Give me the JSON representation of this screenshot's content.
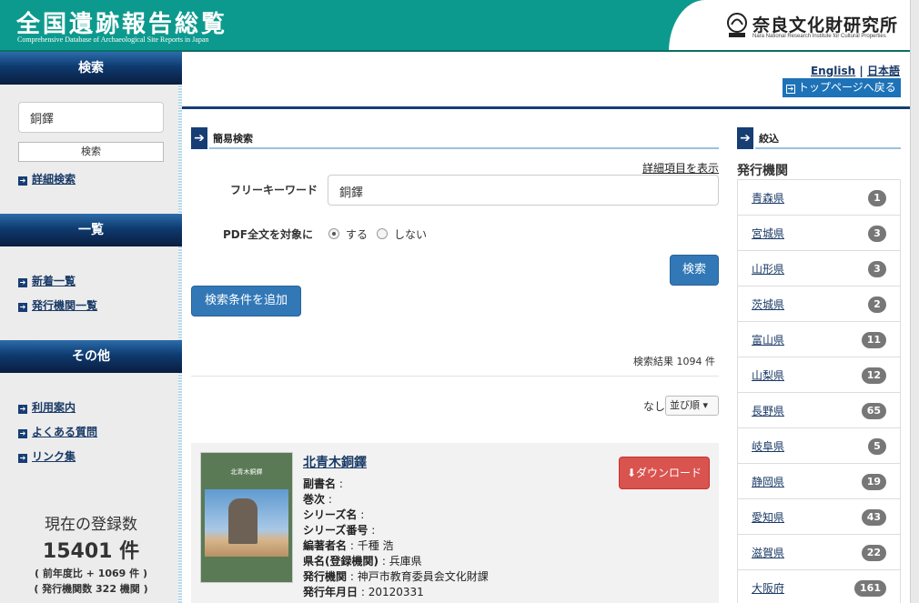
{
  "header": {
    "title": "全国遺跡報告総覧",
    "subtitle": "Comprehensive Database of Archaeological Site Reports in Japan",
    "org_name": "奈良文化財研究所",
    "org_sub": "Nara National Research Institute for Cultural Properties"
  },
  "nav": {
    "lang_en": "English",
    "lang_sep": "|",
    "lang_ja": "日本語",
    "top_page": "トップページへ戻る"
  },
  "sidebar": {
    "search_head": "検索",
    "search_value": "銅鐸",
    "search_button": "検索",
    "detail_search": "詳細検索",
    "list_head": "一覧",
    "list_items": [
      "新着一覧",
      "発行機関一覧"
    ],
    "other_head": "その他",
    "other_items": [
      "利用案内",
      "よくある質問",
      "リンク集"
    ],
    "registered_label": "現在の登録数",
    "registered_count": "15401 件",
    "yoy": "( 前年度比 + 1069 件 )",
    "orgs": "( 発行機関数 322 機関 )"
  },
  "simple_search": {
    "heading": "簡易検索",
    "show_detail": "詳細項目を表示",
    "keyword_label": "フリーキーワード",
    "keyword_value": "銅鐸",
    "pdf_label": "PDF全文を対象に",
    "pdf_yes": "する",
    "pdf_no": "しない",
    "search_button": "検索",
    "add_condition": "検索条件を追加"
  },
  "results": {
    "count_text": "検索結果 1094 件",
    "sort_none": "なし",
    "sort_label": "並び順",
    "items": [
      {
        "title": "北青木銅鐸",
        "cover_title": "北青木銅鐸",
        "fields": [
          {
            "label": "副書名",
            "value": ":"
          },
          {
            "label": "巻次",
            "value": ":"
          },
          {
            "label": "シリーズ名",
            "value": ":"
          },
          {
            "label": "シリーズ番号",
            "value": ":"
          },
          {
            "label": "編著者名",
            "value": ": 千種 浩"
          },
          {
            "label": "県名(登録機関)",
            "value": ": 兵庫県"
          },
          {
            "label": "発行機関",
            "value": ": 神戸市教育委員会文化財課"
          },
          {
            "label": "発行年月日",
            "value": ": 20120331"
          }
        ],
        "download": "ダウンロード"
      }
    ]
  },
  "filter": {
    "heading": "絞込",
    "group_title": "発行機関",
    "items": [
      {
        "name": "青森県",
        "count": "1"
      },
      {
        "name": "宮城県",
        "count": "3"
      },
      {
        "name": "山形県",
        "count": "3"
      },
      {
        "name": "茨城県",
        "count": "2"
      },
      {
        "name": "富山県",
        "count": "11"
      },
      {
        "name": "山梨県",
        "count": "12"
      },
      {
        "name": "長野県",
        "count": "65"
      },
      {
        "name": "岐阜県",
        "count": "5"
      },
      {
        "name": "静岡県",
        "count": "19"
      },
      {
        "name": "愛知県",
        "count": "43"
      },
      {
        "name": "滋賀県",
        "count": "22"
      },
      {
        "name": "大阪府",
        "count": "161"
      }
    ]
  },
  "icons": {
    "arrow": "arrow-right-icon",
    "download": "download-icon",
    "caret": "caret-down-icon"
  }
}
